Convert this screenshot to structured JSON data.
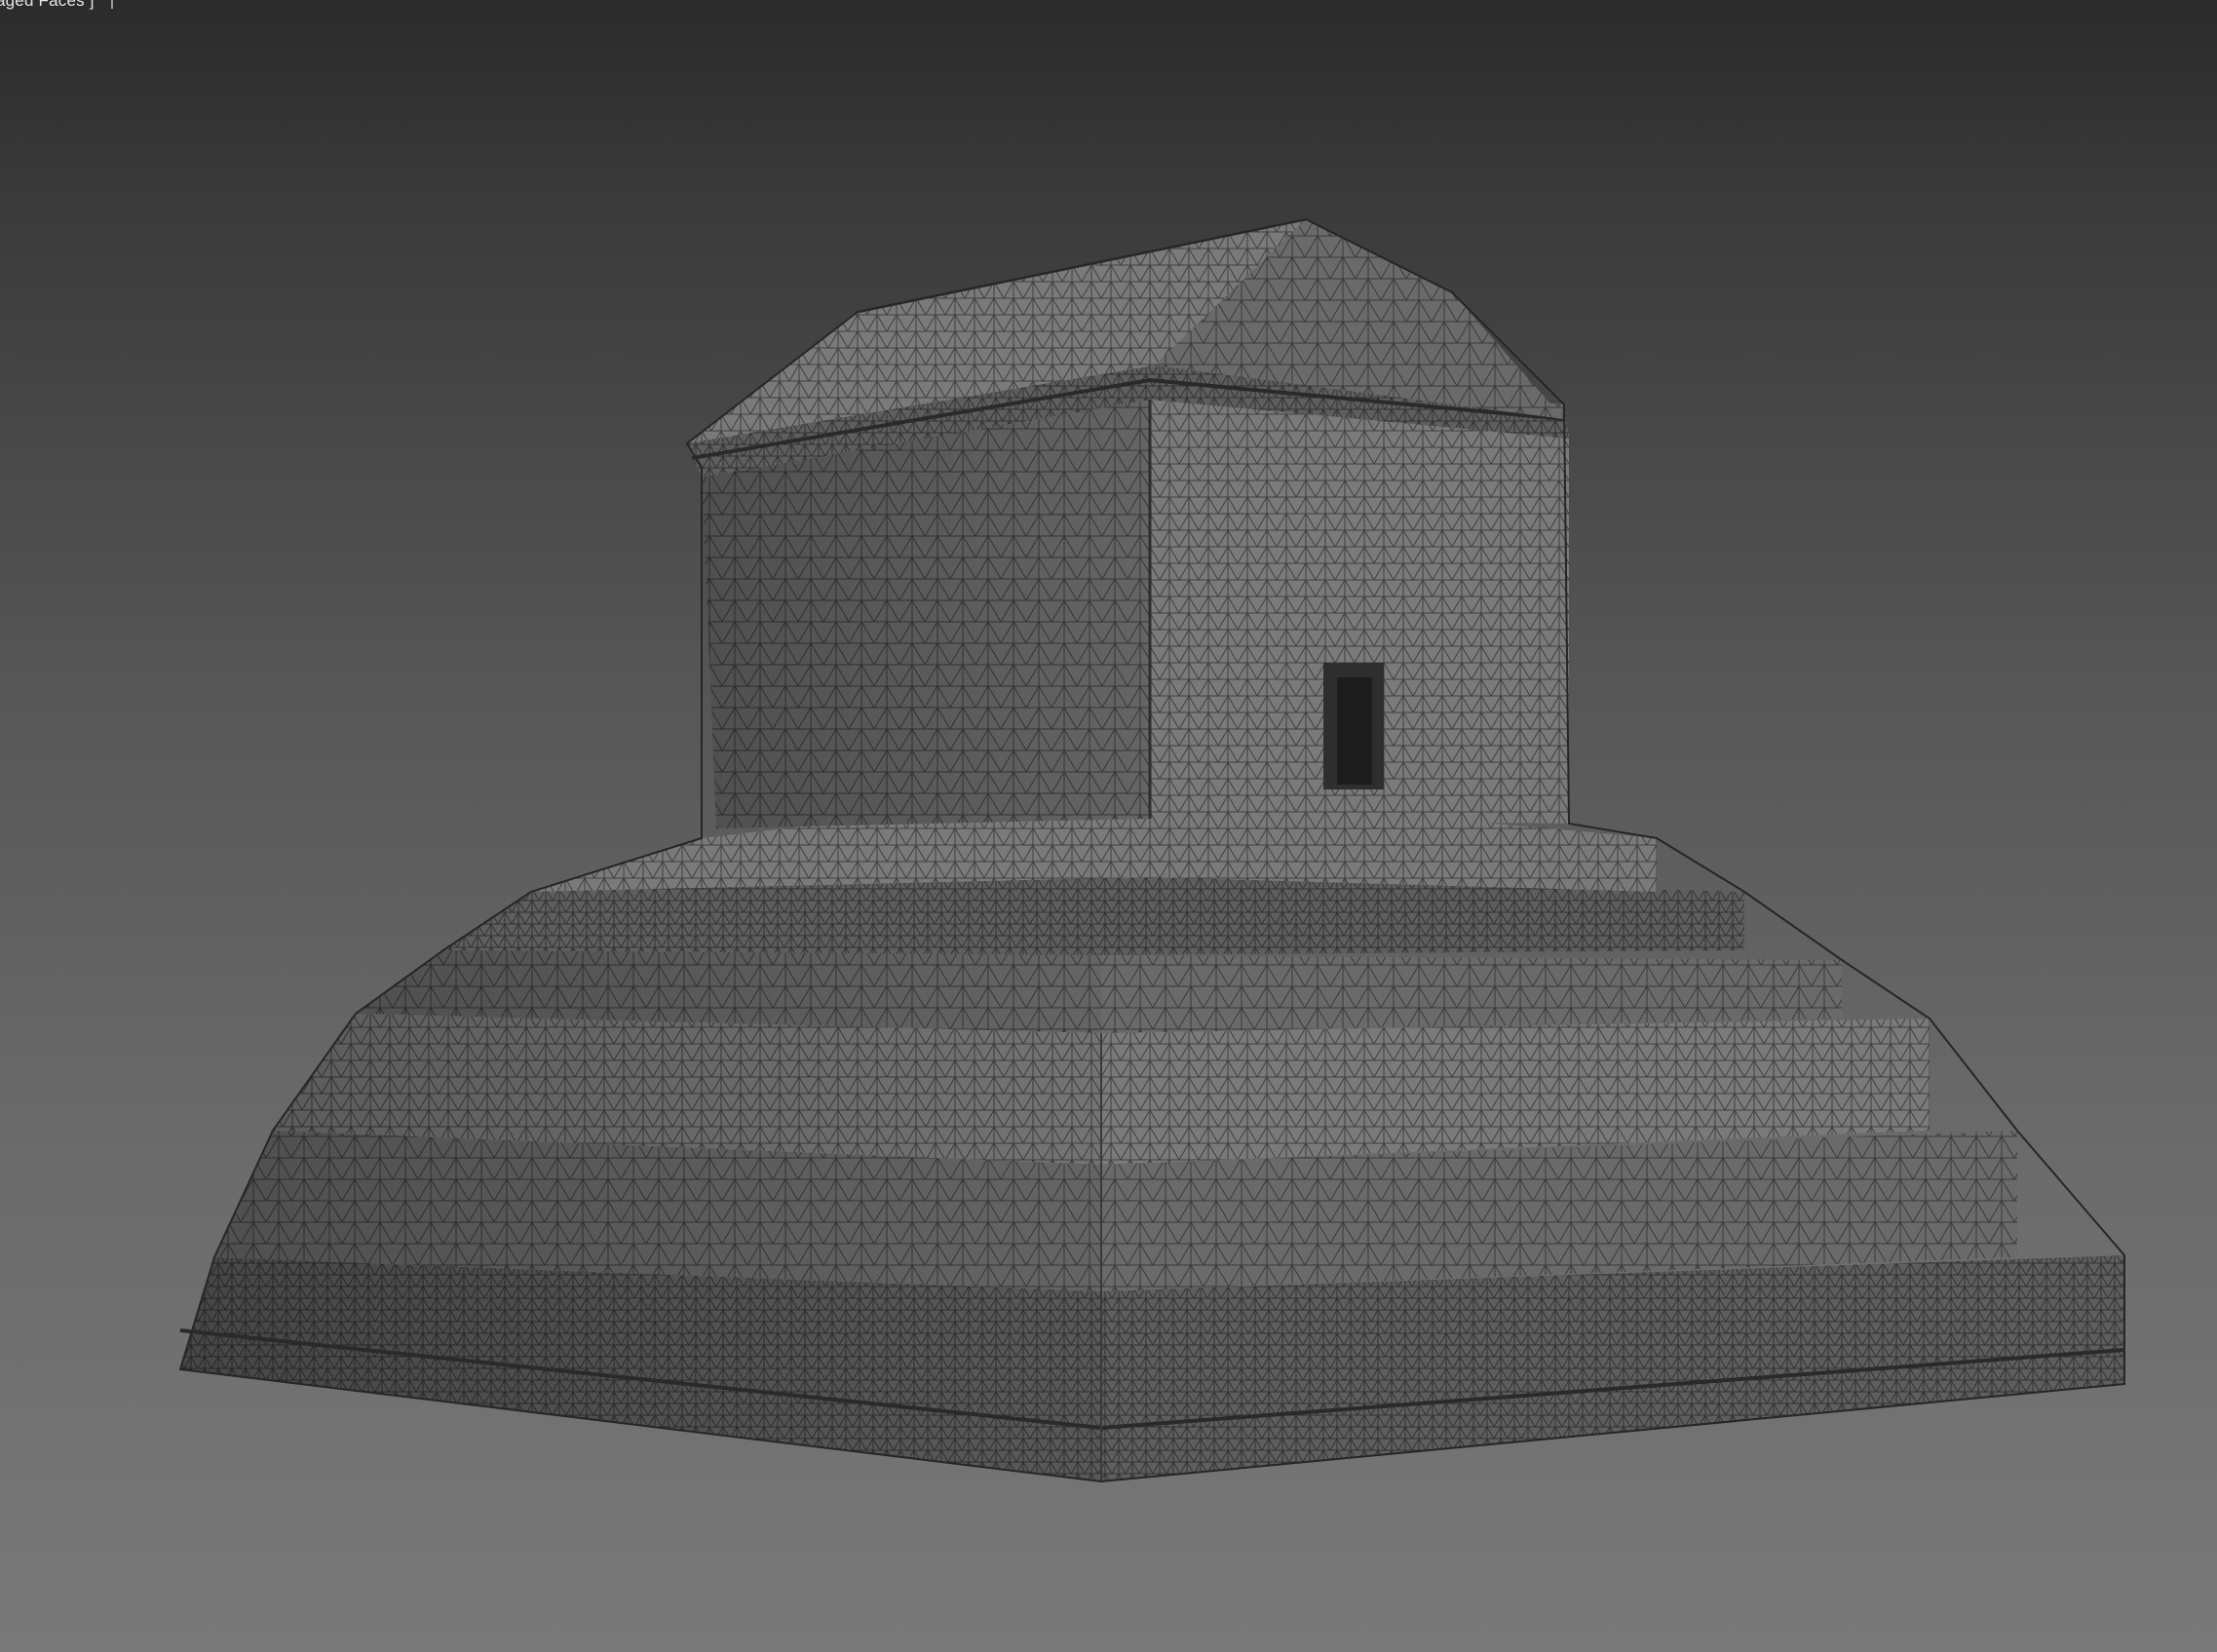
{
  "viewport": {
    "label": "aged Faces ]",
    "background_top": "#2b2b2b",
    "background_bottom": "#787878",
    "wire_color": "#2e2e2e",
    "surface_color": "#6a6a6a"
  },
  "model": {
    "icon": "mesh-object-icon"
  }
}
